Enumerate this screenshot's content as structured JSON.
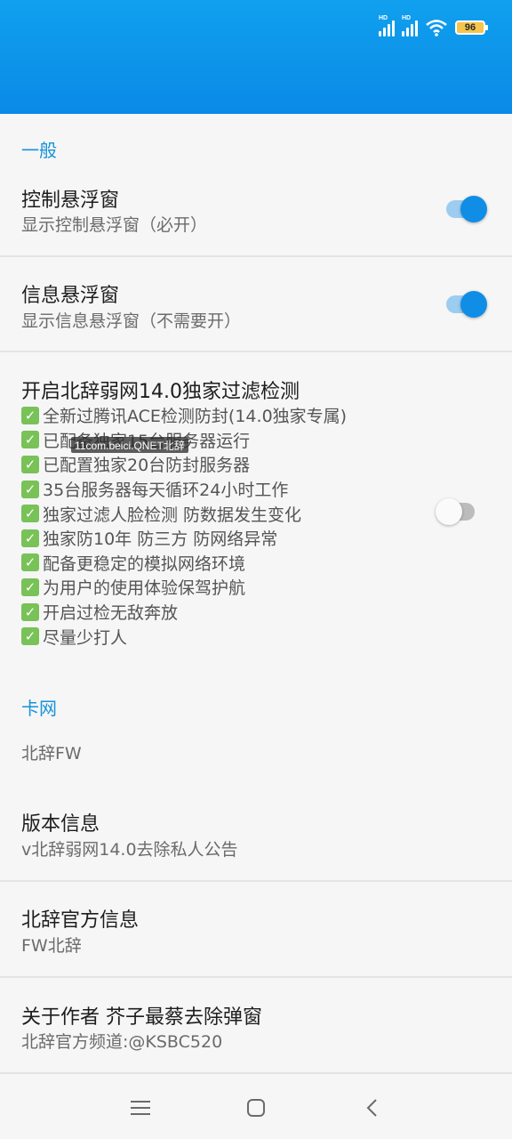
{
  "status_bar": {
    "signal_1_label": "HD",
    "signal_2_label": "HD",
    "wifi_icon": "wifi-icon",
    "battery_level": "96"
  },
  "sections": {
    "general": "一般",
    "card_network": "卡网"
  },
  "settings": {
    "control_float": {
      "title": "控制悬浮窗",
      "subtitle": "显示控制悬浮窗（必开）",
      "enabled": true
    },
    "info_float": {
      "title": "信息悬浮窗",
      "subtitle": "显示信息悬浮窗（不需要开）",
      "enabled": true
    },
    "filter_detect": {
      "title": "开启北辞弱网14.0独家过滤检测",
      "enabled": false,
      "features": [
        "全新过腾讯ACE检测防封(14.0独家专属)",
        "已配备独家15台服务器运行",
        "已配置独家20台防封服务器",
        "35台服务器每天循环24小时工作",
        "独家过滤人脸检测 防数据发生变化",
        "独家防10年 防三方 防网络异常",
        "配备更稳定的模拟网络环境",
        "为用户的使用体验保驾护航",
        "开启过检无敌奔放",
        "尽量少打人"
      ],
      "watermark": "11com.beici.QNET北辞"
    }
  },
  "card_network": {
    "name": "北辞FW"
  },
  "version": {
    "title": "版本信息",
    "subtitle": "v北辞弱网14.0去除私人公告"
  },
  "official": {
    "title": "北辞官方信息",
    "subtitle": "FW北辞"
  },
  "author": {
    "title": "关于作者 芥子最蔡去除弹窗",
    "subtitle": "北辞官方频道:@KSBC520"
  },
  "colors": {
    "appbar": "#0a8ae6",
    "accent": "#1792d8",
    "switch_on": "#108ee6",
    "check": "#78c257"
  }
}
